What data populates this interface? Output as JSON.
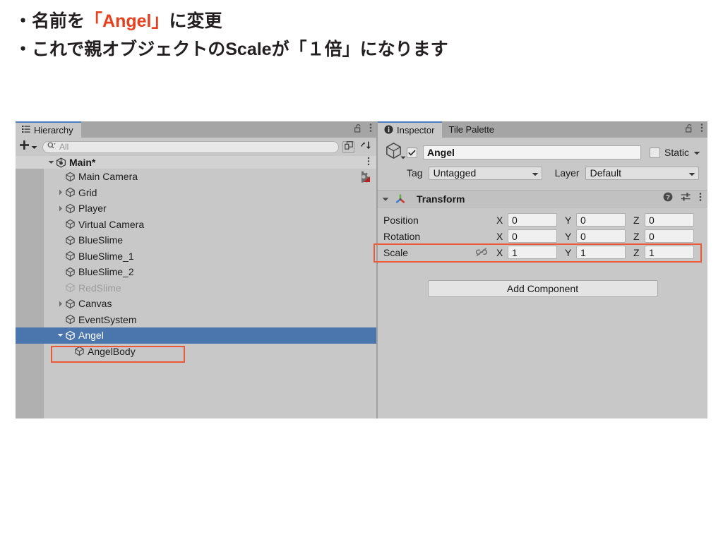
{
  "caption": {
    "line1_pre": "・名前を",
    "line1_hl": "「Angel」",
    "line1_post": "に変更",
    "line2": "・これで親オブジェクトのScaleが「１倍」になります",
    "highlight_color": "#e8401f"
  },
  "hierarchy": {
    "tab_label": "Hierarchy",
    "tab_icon": "list-icon",
    "lock_icon": "lock-open-icon",
    "menu_icon": "kebab-menu-icon",
    "toolbar": {
      "create_icon": "plus-icon",
      "create_dropdown_icon": "chevron-down-icon",
      "search_icon": "search-icon",
      "search_value": "",
      "search_placeholder": "All",
      "expand_icon": "expand-window-icon",
      "sort_icon": "sort-icon"
    },
    "scene": {
      "label": "Main*",
      "icon": "unity-scene-icon",
      "twisty": "triangle-down",
      "menu_icon": "kebab-menu-icon"
    },
    "items": [
      {
        "label": "Main Camera",
        "indent": 2,
        "twisty": "none",
        "dim": false,
        "selected": false,
        "extra_icon": "cinemachine-brain-icon"
      },
      {
        "label": "Grid",
        "indent": 2,
        "twisty": "triangle-right",
        "dim": false,
        "selected": false,
        "extra_icon": ""
      },
      {
        "label": "Player",
        "indent": 2,
        "twisty": "triangle-right",
        "dim": false,
        "selected": false,
        "extra_icon": ""
      },
      {
        "label": "Virtual Camera",
        "indent": 2,
        "twisty": "none",
        "dim": false,
        "selected": false,
        "extra_icon": ""
      },
      {
        "label": "BlueSlime",
        "indent": 2,
        "twisty": "none",
        "dim": false,
        "selected": false,
        "extra_icon": ""
      },
      {
        "label": "BlueSlime_1",
        "indent": 2,
        "twisty": "none",
        "dim": false,
        "selected": false,
        "extra_icon": ""
      },
      {
        "label": "BlueSlime_2",
        "indent": 2,
        "twisty": "none",
        "dim": false,
        "selected": false,
        "extra_icon": ""
      },
      {
        "label": "RedSlime",
        "indent": 2,
        "twisty": "none",
        "dim": true,
        "selected": false,
        "extra_icon": ""
      },
      {
        "label": "Canvas",
        "indent": 2,
        "twisty": "triangle-right",
        "dim": false,
        "selected": false,
        "extra_icon": ""
      },
      {
        "label": "EventSystem",
        "indent": 2,
        "twisty": "none",
        "dim": false,
        "selected": false,
        "extra_icon": ""
      },
      {
        "label": "Angel",
        "indent": 2,
        "twisty": "triangle-down",
        "dim": false,
        "selected": true,
        "extra_icon": ""
      },
      {
        "label": "AngelBody",
        "indent": 3,
        "twisty": "none",
        "dim": false,
        "selected": false,
        "extra_icon": ""
      }
    ]
  },
  "inspector": {
    "tabs": [
      {
        "label": "Inspector",
        "active": true,
        "icon": "info-icon"
      },
      {
        "label": "Tile Palette",
        "active": false,
        "icon": ""
      }
    ],
    "lock_icon": "lock-open-icon",
    "menu_icon": "kebab-menu-icon",
    "gameobject": {
      "icon": "cube-icon",
      "enabled": true,
      "name_value": "Angel",
      "static_label": "Static",
      "static_checked": false,
      "static_dropdown_icon": "chevron-down-icon"
    },
    "tag_label": "Tag",
    "tag_value": "Untagged",
    "layer_label": "Layer",
    "layer_value": "Default",
    "transform": {
      "title": "Transform",
      "icon": "transform-axis-icon",
      "twisty": "triangle-down",
      "help_icon": "help-icon",
      "preset_icon": "preset-sliders-icon",
      "menu_icon": "kebab-menu-icon",
      "rows": [
        {
          "label": "Position",
          "link_icon": "",
          "x": "0",
          "y": "0",
          "z": "0",
          "highlighted": false
        },
        {
          "label": "Rotation",
          "link_icon": "",
          "x": "0",
          "y": "0",
          "z": "0",
          "highlighted": false
        },
        {
          "label": "Scale",
          "link_icon": "broken-link-icon",
          "x": "1",
          "y": "1",
          "z": "1",
          "highlighted": true
        }
      ],
      "axis_labels": {
        "x": "X",
        "y": "Y",
        "z": "Z"
      }
    },
    "add_component_label": "Add Component"
  },
  "highlight_boxes": {
    "color": "#eb5a38"
  }
}
